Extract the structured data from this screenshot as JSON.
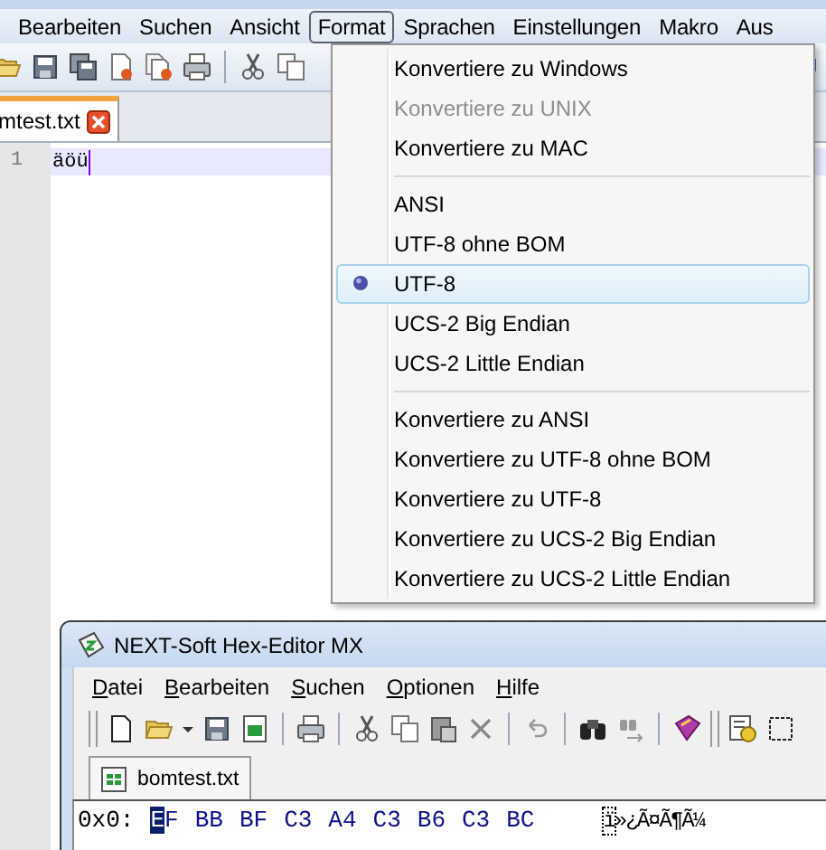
{
  "main_window": {
    "menu": [
      {
        "label": "Bearbeiten",
        "selected": false
      },
      {
        "label": "Suchen",
        "selected": false
      },
      {
        "label": "Ansicht",
        "selected": false
      },
      {
        "label": "Format",
        "selected": true
      },
      {
        "label": "Sprachen",
        "selected": false
      },
      {
        "label": "Einstellungen",
        "selected": false
      },
      {
        "label": "Makro",
        "selected": false
      },
      {
        "label": "Aus",
        "selected": false
      }
    ],
    "tab": {
      "label": "mtest.txt"
    },
    "editor": {
      "line_number": "1",
      "text": "äöü"
    }
  },
  "format_menu": {
    "groups": [
      [
        {
          "label": "Konvertiere zu Windows",
          "disabled": false,
          "selected": false
        },
        {
          "label": "Konvertiere zu UNIX",
          "disabled": true,
          "selected": false
        },
        {
          "label": "Konvertiere zu MAC",
          "disabled": false,
          "selected": false
        }
      ],
      [
        {
          "label": "ANSI",
          "disabled": false,
          "selected": false
        },
        {
          "label": "UTF-8 ohne BOM",
          "disabled": false,
          "selected": false
        },
        {
          "label": "UTF-8",
          "disabled": false,
          "selected": true
        },
        {
          "label": "UCS-2 Big Endian",
          "disabled": false,
          "selected": false
        },
        {
          "label": "UCS-2 Little Endian",
          "disabled": false,
          "selected": false
        }
      ],
      [
        {
          "label": "Konvertiere zu ANSI",
          "disabled": false,
          "selected": false
        },
        {
          "label": "Konvertiere zu UTF-8 ohne BOM",
          "disabled": false,
          "selected": false
        },
        {
          "label": "Konvertiere zu UTF-8",
          "disabled": false,
          "selected": false
        },
        {
          "label": "Konvertiere zu UCS-2 Big Endian",
          "disabled": false,
          "selected": false
        },
        {
          "label": "Konvertiere zu UCS-2 Little Endian",
          "disabled": false,
          "selected": false
        }
      ]
    ]
  },
  "hex_editor": {
    "title": "NEXT-Soft Hex-Editor MX",
    "menu": [
      "Datei",
      "Bearbeiten",
      "Suchen",
      "Optionen",
      "Hilfe"
    ],
    "tab": "bomtest.txt",
    "rows": [
      {
        "offset": "0x0:",
        "bytes": [
          {
            "value": "EF",
            "cursor": true
          },
          {
            "value": "BB",
            "cursor": false
          },
          {
            "value": "BF",
            "cursor": false
          },
          {
            "value": "C3",
            "cursor": false
          },
          {
            "value": "A4",
            "cursor": false
          },
          {
            "value": "C3",
            "cursor": false
          },
          {
            "value": "B6",
            "cursor": false
          },
          {
            "value": "C3",
            "cursor": false
          },
          {
            "value": "BC",
            "cursor": false
          }
        ],
        "ascii_chars": [
          "ï",
          "»",
          "¿",
          "Ã",
          "¤",
          "Ã",
          "¶",
          "Ã",
          "¼"
        ]
      }
    ]
  }
}
